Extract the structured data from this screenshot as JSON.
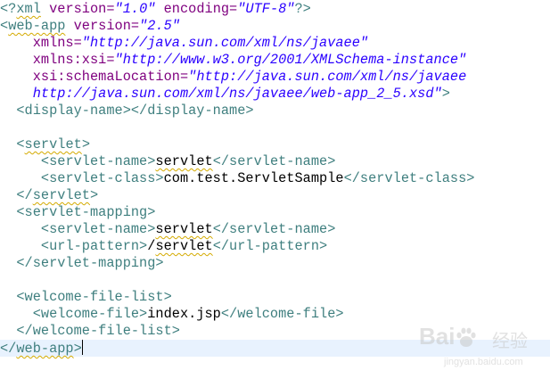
{
  "editor": {
    "lines": [
      [
        "<?",
        "xml",
        " version=",
        "\"1.0\"",
        " encoding=",
        "\"UTF-8\"",
        "?>"
      ],
      [
        "<",
        "web-app",
        " version=",
        "\"2.5\""
      ],
      [
        "    ",
        "xmlns=",
        "\"http://java.sun.com/xml/ns/javaee\""
      ],
      [
        "    ",
        "xmlns:xsi=",
        "\"http://www.w3.org/2001/XMLSchema-instance\""
      ],
      [
        "    ",
        "xsi:schemaLocation=",
        "\"http://java.sun.com/xml/ns/javaee"
      ],
      [
        "    ",
        "http://java.sun.com/xml/ns/javaee/web-app_2_5.xsd\"",
        ">"
      ],
      [
        "  ",
        "<display-name></display-name>"
      ],
      [
        ""
      ],
      [
        "  ",
        "<",
        "servlet",
        ">"
      ],
      [
        "     ",
        "<servlet-name>",
        "servlet",
        "</servlet-name>"
      ],
      [
        "     ",
        "<servlet-class>",
        "com.test.ServletSample",
        "</servlet-class>"
      ],
      [
        "  ",
        "</",
        "servlet",
        ">"
      ],
      [
        "  ",
        "<servlet-mapping>"
      ],
      [
        "     ",
        "<servlet-name>",
        "servlet",
        "</servlet-name>"
      ],
      [
        "     ",
        "<url-pattern>",
        "/",
        "servlet",
        "</url-pattern>"
      ],
      [
        "  ",
        "</servlet-mapping>"
      ],
      [
        ""
      ],
      [
        "  ",
        "<welcome-file-list>"
      ],
      [
        "    ",
        "<welcome-file>",
        "index.jsp",
        "</welcome-file>"
      ],
      [
        "  ",
        "</welcome-file-list>"
      ],
      [
        "</",
        "web-app",
        ">"
      ]
    ],
    "colors": {
      "tag": "#3f7f7f",
      "attribute": "#7f007f",
      "string": "#2a00ff",
      "text": "#000000",
      "current_line": "#e8f2fe",
      "spell_squiggle": "#d4aa00"
    }
  },
  "watermark": {
    "logo": "Bai",
    "paw_icon": "baidu-paw-icon",
    "name_cn": "经验",
    "url": "jingyan.baidu.com"
  }
}
